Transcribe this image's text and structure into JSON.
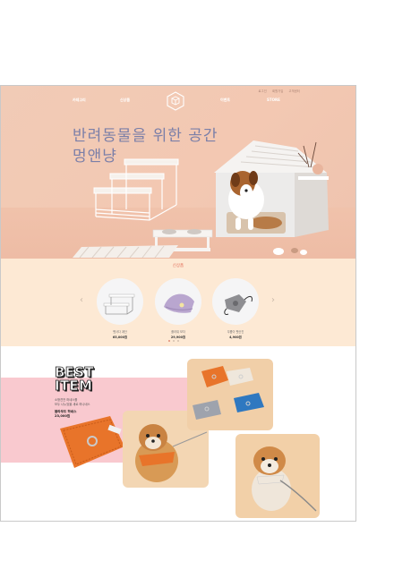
{
  "top_links": [
    "로그인",
    "회원가입",
    "고객센터"
  ],
  "nav": {
    "items": [
      "카테고리",
      "신상품",
      "이벤트",
      "STORE"
    ]
  },
  "hero": {
    "headline_line1": "반려동물을 위한 공간",
    "headline_line2": "멍앤냥"
  },
  "new_products": {
    "title": "신상품",
    "prev_icon": "chevron-left-icon",
    "next_icon": "chevron-right-icon",
    "items": [
      {
        "name": "펫사다 계단",
        "price": "65,000원"
      },
      {
        "name": "플라워 모자",
        "price": "29,900원"
      },
      {
        "name": "무릎이 펫산진",
        "price": "4,900원"
      }
    ]
  },
  "best": {
    "title_line1": "BEST",
    "title_line2": "ITEM",
    "desc_line1": "소형견전 하네스를",
    "desc_line2": "모두 나누었을 새로 하나네스",
    "name": "볼라우드 하네스",
    "price": "23,000원"
  },
  "colors": {
    "hero_bg": "#f1cbb6",
    "new_bg": "#fde9d4",
    "best_pink": "#f9c9cf",
    "headline": "#7b7fa8",
    "new_title": "#e36e5a"
  }
}
